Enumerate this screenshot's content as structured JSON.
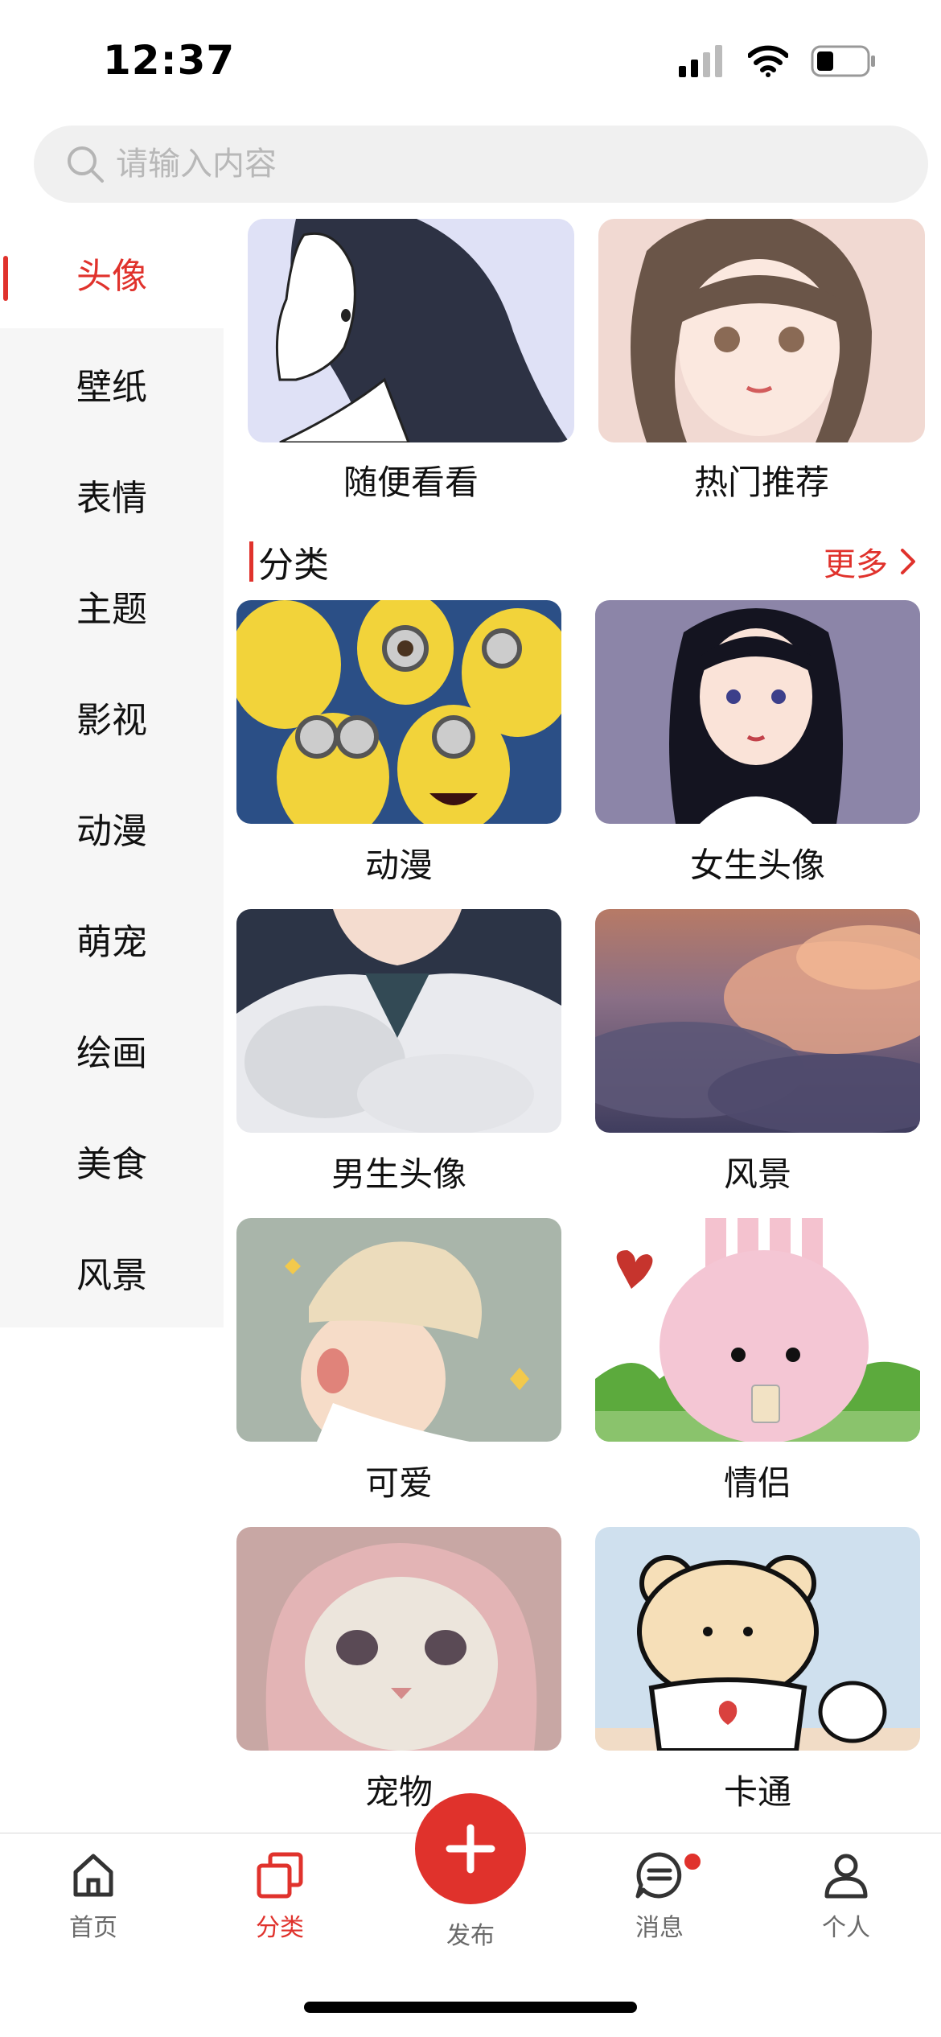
{
  "status_bar": {
    "time": "12:37"
  },
  "search": {
    "placeholder": "请输入内容"
  },
  "sidebar": {
    "items": [
      {
        "label": "头像",
        "active": true
      },
      {
        "label": "壁纸"
      },
      {
        "label": "表情"
      },
      {
        "label": "主题"
      },
      {
        "label": "影视"
      },
      {
        "label": "动漫"
      },
      {
        "label": "萌宠"
      },
      {
        "label": "绘画"
      },
      {
        "label": "美食"
      },
      {
        "label": "风景"
      }
    ]
  },
  "top_cards": [
    {
      "label": "随便看看"
    },
    {
      "label": "热门推荐"
    }
  ],
  "section": {
    "title": "分类",
    "more": "更多"
  },
  "categories": [
    {
      "label": "动漫"
    },
    {
      "label": "女生头像"
    },
    {
      "label": "男生头像"
    },
    {
      "label": "风景"
    },
    {
      "label": "可爱"
    },
    {
      "label": "情侣"
    },
    {
      "label": "宠物"
    },
    {
      "label": "卡通"
    }
  ],
  "tabbar": {
    "home": "首页",
    "category": "分类",
    "publish": "发布",
    "messages": "消息",
    "profile": "个人"
  },
  "colors": {
    "accent": "#e0322c",
    "sidebar_bg": "#f6f6f6",
    "search_bg": "#f0f0f0"
  }
}
